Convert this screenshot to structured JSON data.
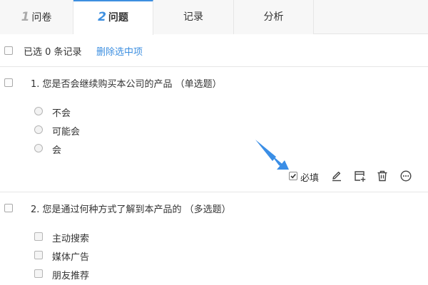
{
  "tabs": [
    {
      "num": "1",
      "label": "问卷"
    },
    {
      "num": "2",
      "label": "问题"
    },
    {
      "num": "",
      "label": "记录"
    },
    {
      "num": "",
      "label": "分析"
    }
  ],
  "selection": {
    "text": "已选 0 条记录",
    "delete_label": "删除选中项"
  },
  "questions": [
    {
      "title": "1. 您是否会继续购买本公司的产品  （单选题）",
      "options": [
        "不会",
        "可能会",
        "会"
      ]
    },
    {
      "title": "2. 您是通过何种方式了解到本产品的  （多选题）",
      "options": [
        "主动搜索",
        "媒体广告",
        "朋友推荐"
      ]
    }
  ],
  "toolbar": {
    "required_label": "必填",
    "icons": [
      "edit-icon",
      "add-card-icon",
      "trash-icon",
      "more-icon"
    ]
  },
  "colors": {
    "accent": "#3d8fe0",
    "arrow": "#3a8ee6",
    "border": "#e6e6e6"
  }
}
